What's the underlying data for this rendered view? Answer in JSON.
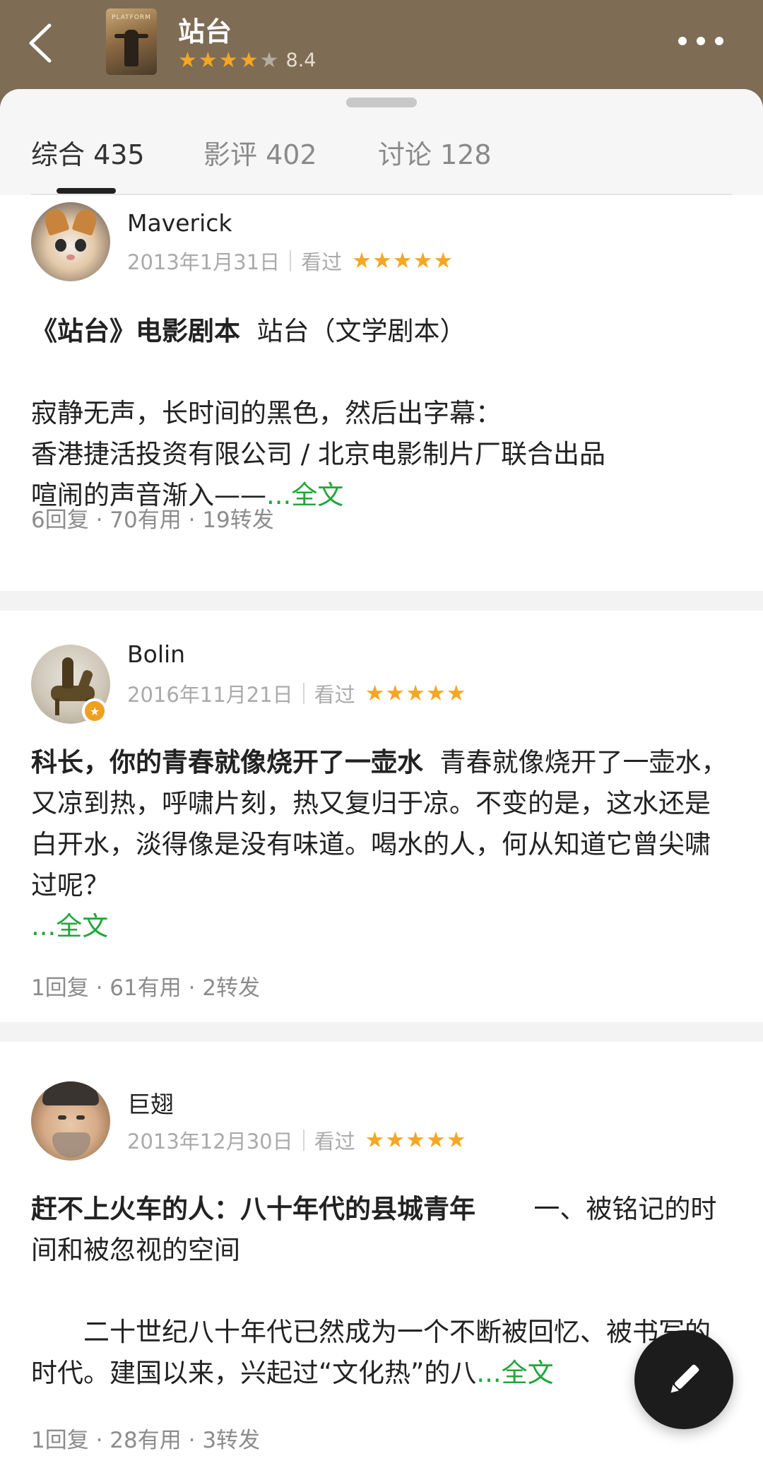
{
  "header": {
    "poster_text": "PLATFORM",
    "title": "站台",
    "stars_filled": 4,
    "stars_total": 5,
    "rating": "8.4"
  },
  "tabs": [
    {
      "label": "综合 435",
      "active": true
    },
    {
      "label": "影评 402",
      "active": false
    },
    {
      "label": "讨论 128",
      "active": false
    }
  ],
  "reviews": [
    {
      "username": "Maverick",
      "date": "2013年1月31日",
      "status": "看过",
      "stars": 5,
      "title": "《站台》电影剧本",
      "body_lines": [
        "站台（文学剧本）",
        "",
        "寂静无声，长时间的黑色，然后出字幕：",
        "香港捷活投资有限公司 / 北京电影制片厂联合出品",
        "喧闹的声音渐入——"
      ],
      "more": "...全文",
      "replies": "6回复",
      "useful": "70有用",
      "shares": "19转发"
    },
    {
      "username": "Bolin",
      "date": "2016年11月21日",
      "status": "看过",
      "stars": 5,
      "title": "科长，你的青春就像烧开了一壶水",
      "body": "青春就像烧开了一壶水，又凉到热，呼啸片刻，热又复归于凉。不变的是，这水还是白开水，淡得像是没有味道。喝水的人，何从知道它曾尖啸过呢？",
      "more": "...全文",
      "replies": "1回复",
      "useful": "61有用",
      "shares": "2转发"
    },
    {
      "username": "巨翅",
      "date": "2013年12月30日",
      "status": "看过",
      "stars": 5,
      "title": "赶不上火车的人：八十年代的县城青年",
      "body_lines": [
        "一、被铭记的时间和被忽视的空间",
        "",
        "二十世纪八十年代已然成为一个不断被回忆、被书写的时代。建国以来，兴起过“文化热”的八"
      ],
      "more": "...全文",
      "replies": "1回复",
      "useful": "28有用",
      "shares": "3转发"
    }
  ],
  "stats_separator": " · ",
  "colors": {
    "header_bg": "#7e6c55",
    "star": "#f5a623",
    "link_green": "#22a53b"
  },
  "icons": {
    "back": "chevron-left-icon",
    "more": "more-dots-icon",
    "fab": "pencil-icon"
  }
}
